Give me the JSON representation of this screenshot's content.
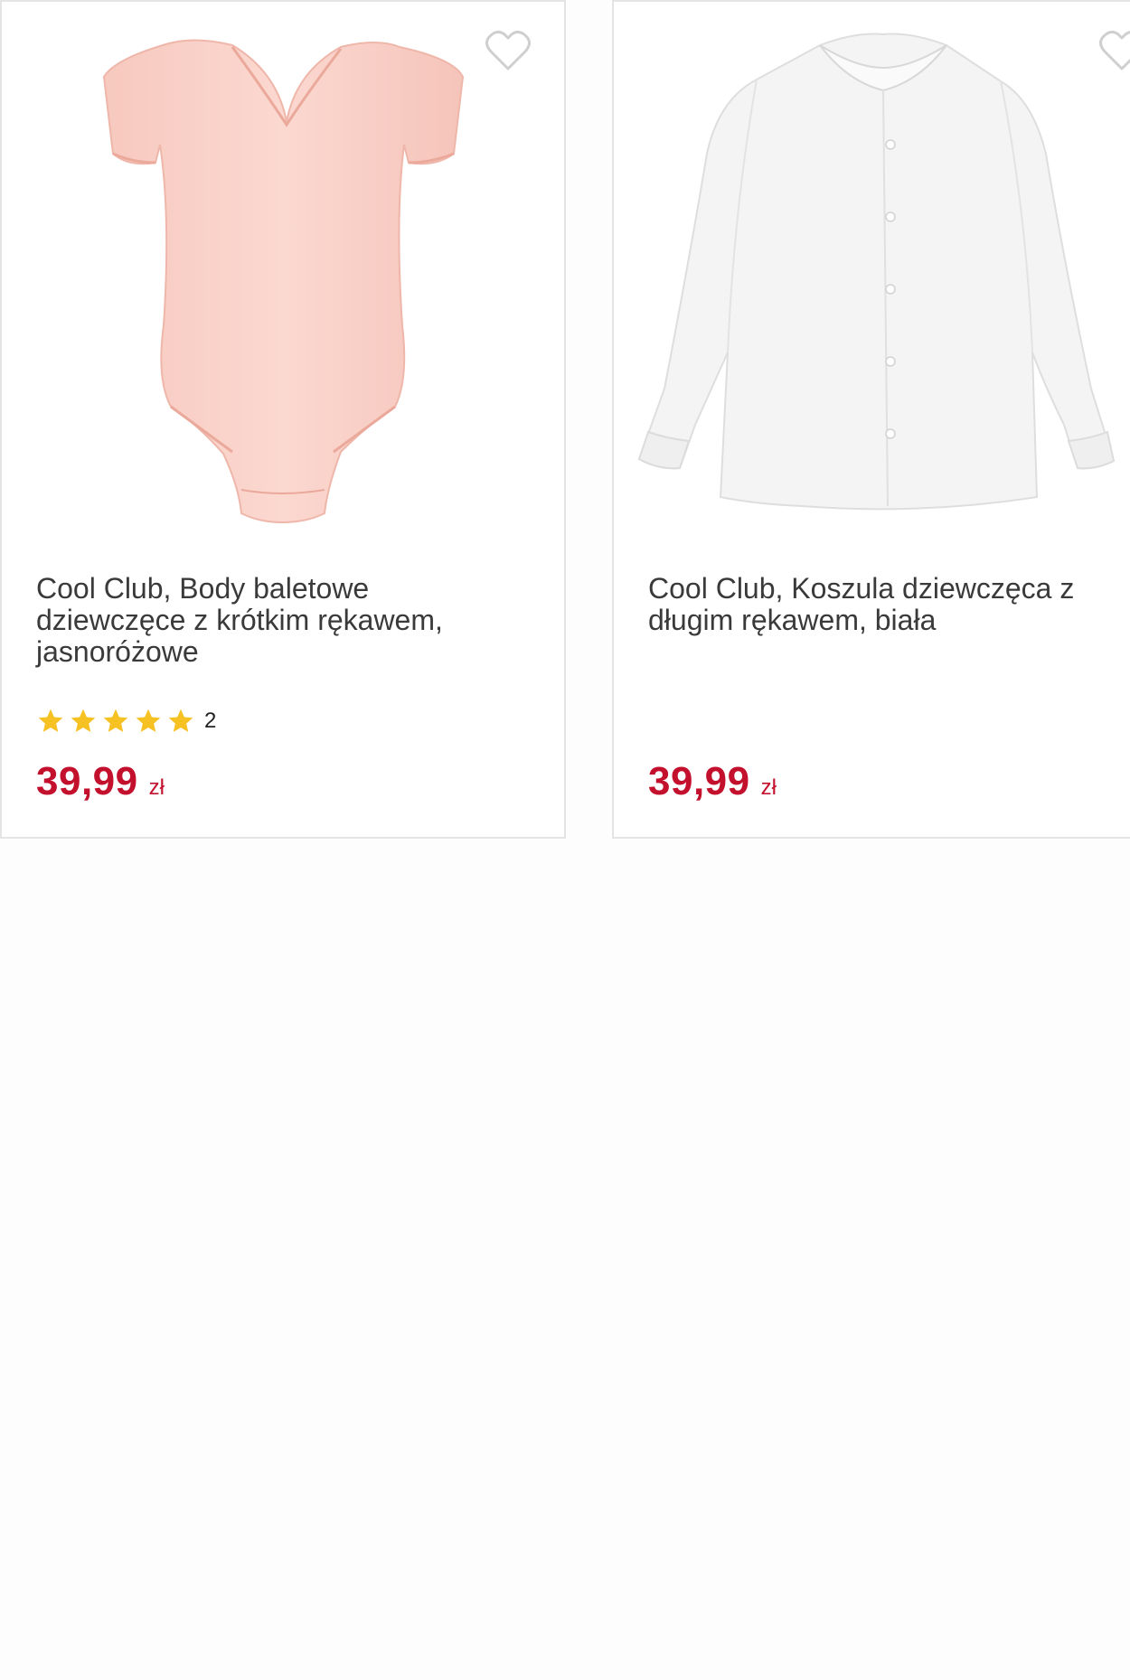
{
  "colors": {
    "price": "#c3102d",
    "star": "#f5c123",
    "heart_outline": "#cfcfcf",
    "card_border": "#e4e4e4"
  },
  "products": [
    {
      "title": "Cool Club, Body baletowe dziewczęce z krótkim rękawem, jasnoróżowe",
      "image": "pink-ballet-bodysuit",
      "rating_stars": 5,
      "rating_count": "2",
      "price": "39,99",
      "currency": "zł",
      "wishlist_icon": "heart-outline-icon"
    },
    {
      "title": "Cool Club, Koszula dziewczęca z długim rękawem, biała",
      "image": "white-long-sleeve-shirt",
      "price": "39,99",
      "currency": "zł",
      "wishlist_icon": "heart-outline-icon"
    }
  ]
}
